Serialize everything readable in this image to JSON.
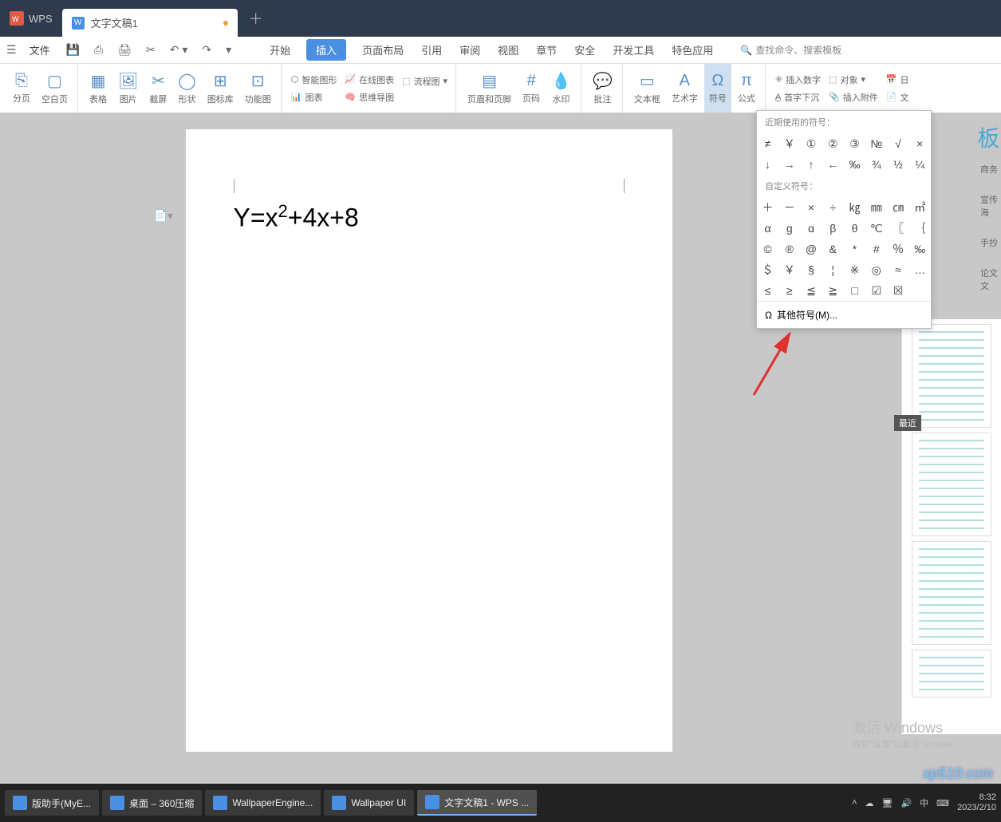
{
  "titlebar": {
    "app": "WPS",
    "tab_title": "文字文稿1"
  },
  "quickaccess": {
    "file": "文件"
  },
  "menus": [
    "开始",
    "插入",
    "页面布局",
    "引用",
    "审阅",
    "视图",
    "章节",
    "安全",
    "开发工具",
    "特色应用"
  ],
  "menu_active_index": 1,
  "search_placeholder": "查找命令、搜索模板",
  "ribbon": {
    "g1": [
      "分页",
      "空白页"
    ],
    "g2": [
      "表格",
      "图片",
      "截屏",
      "形状",
      "图标库",
      "功能图"
    ],
    "smart_shape": "智能图形",
    "online_chart": "在线图表",
    "flow": "流程图",
    "chart": "图表",
    "mind": "思维导图",
    "g3": [
      "页眉和页脚",
      "页码",
      "水印"
    ],
    "g4_label": "批注",
    "g5": [
      "文本框",
      "艺术字",
      "符号",
      "公式"
    ],
    "first_line": "首字下沉",
    "insert_num": "插入数字",
    "object": "对象",
    "calendar": "日",
    "insert_attach": "插入附件",
    "text": "文"
  },
  "popup": {
    "recent_header": "近期使用的符号：",
    "recent": [
      "≠",
      "￥",
      "①",
      "②",
      "③",
      "№",
      "√",
      "×",
      "↓",
      "→",
      "↑",
      "←",
      "‰",
      "¾",
      "½",
      "¼"
    ],
    "custom_header": "自定义符号：",
    "custom": [
      "＋",
      "－",
      "×",
      "÷",
      "㎏",
      "㎜",
      "㎝",
      "㎡",
      "α",
      "ɡ",
      "ɑ",
      "β",
      "θ",
      "℃",
      "〖",
      "｛",
      "©",
      "®",
      "@",
      "&",
      "*",
      "#",
      "％",
      "‰",
      "＄",
      "￥",
      "§",
      "¦",
      "※",
      "◎",
      "≈",
      "…",
      "≤",
      "≥",
      "≦",
      "≧",
      "□",
      "☑",
      "☒",
      ""
    ],
    "more": "其他符号(M)..."
  },
  "document": {
    "equation_html": "Y=x<sup>2</sup>+4x+8"
  },
  "right_panel": {
    "templates_label": "板,",
    "tabs": [
      "商务",
      "宣传海",
      "手抄",
      "论文文"
    ],
    "recent": "最近"
  },
  "watermark": {
    "title": "激活 Windows",
    "sub": "转到\"设置\"以激活 Window"
  },
  "taskbar": {
    "items": [
      "版助手(MyE...",
      "桌面 – 360压缩",
      "WallpaperEngine...",
      "Wallpaper UI",
      "文字文稿1 - WPS ..."
    ],
    "active_index": 4,
    "time": "8:32",
    "date": "2023/2/10",
    "ime": "中"
  },
  "site_wm": "xp510.com"
}
